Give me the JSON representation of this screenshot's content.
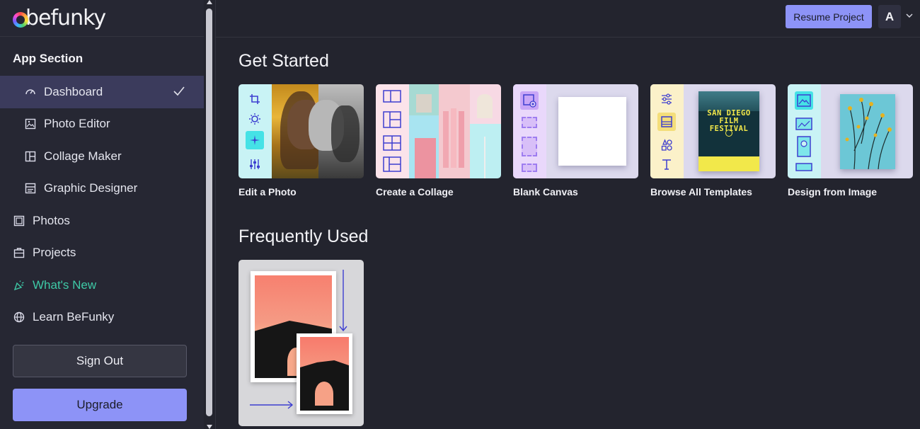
{
  "app": {
    "logo_text": "befunky"
  },
  "sidebar": {
    "section_title": "App Section",
    "items": [
      {
        "label": "Dashboard",
        "icon": "dashboard-icon",
        "active": true
      },
      {
        "label": "Photo Editor",
        "icon": "photo-editor-icon"
      },
      {
        "label": "Collage Maker",
        "icon": "collage-maker-icon"
      },
      {
        "label": "Graphic Designer",
        "icon": "graphic-designer-icon"
      },
      {
        "label": "Photos",
        "icon": "photos-icon"
      },
      {
        "label": "Projects",
        "icon": "projects-icon"
      },
      {
        "label": "What's New",
        "icon": "party-popper-icon"
      },
      {
        "label": "Learn BeFunky",
        "icon": "globe-icon"
      }
    ],
    "sign_out_label": "Sign Out",
    "upgrade_label": "Upgrade"
  },
  "header": {
    "resume_label": "Resume Project",
    "avatar_initial": "A"
  },
  "main": {
    "get_started_title": "Get Started",
    "cards": [
      {
        "label": "Edit a Photo"
      },
      {
        "label": "Create a Collage"
      },
      {
        "label": "Blank Canvas"
      },
      {
        "label": "Browse All Templates",
        "poster_title": "SAN DIEGO FILM FESTIVAL"
      },
      {
        "label": "Design from Image"
      }
    ],
    "frequently_used_title": "Frequently Used"
  },
  "colors": {
    "background": "#23242e",
    "sidebar": "#262733",
    "active_item": "#3b3b5c",
    "accent_button": "#8d93f7",
    "whats_new": "#3ec9a6"
  }
}
